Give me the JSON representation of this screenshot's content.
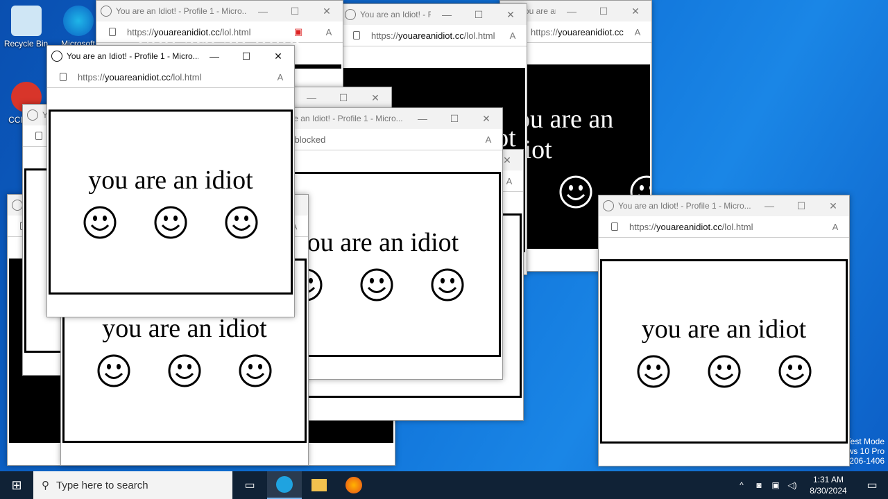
{
  "desktop": {
    "icons": [
      {
        "label": "Recycle Bin"
      },
      {
        "label": "Microsoft Edge"
      },
      {
        "label": "CCleaner"
      }
    ],
    "watermark": [
      "Test Mode",
      "Windows 10 Pro",
      "Build 19041.vb_release.191206-1406"
    ]
  },
  "windows": [
    {
      "title": "You are an Idiot! - Profile 1 - Micro...",
      "url_pre": "https://",
      "url_host": "youareanidiot.cc",
      "url_path": "/lol.html",
      "text": "you are an idiot",
      "theme": "black",
      "popup": ""
    },
    {
      "title": "You are an Idiot! - Profile 1 - Micro...",
      "url_pre": "https://",
      "url_host": "youareanidiot.cc",
      "url_path": "/lol.html",
      "text": "you are an idiot",
      "theme": "black",
      "popup": ""
    },
    {
      "title": "You are an Idiot! - Profile 1 - Micro...",
      "url_pre": "https://",
      "url_host": "youareanidiot.cc",
      "url_path": "/lol.html",
      "text": "you are an idiot",
      "theme": "black",
      "popup": ""
    },
    {
      "title": "You are an Idiot! - Profile 1 - Micro...",
      "url_pre": "https://",
      "url_host": "youareanidiot.cc",
      "url_path": "/lol.html",
      "text": "you are an idiot",
      "theme": "black",
      "popup": ""
    },
    {
      "title": "You are an Idiot! - Profile 1 - Micro...",
      "url_pre": "https://",
      "url_host": "youareanidiot.cc",
      "url_path": "/lol.html",
      "text": "you are an idiot",
      "theme": "white",
      "popup": ""
    },
    {
      "title": "You are an Idiot! - Profile 1 - Micro...",
      "url_pre": "https://",
      "url_host": "youareanidiot.cc",
      "url_path": "/lol.html",
      "text": "you are an idiot",
      "theme": "black",
      "popup": ""
    },
    {
      "title": "You are an Idiot! - Profile 1 - Micro...",
      "url_pre": "https://",
      "url_host": "youareanidiot.cc",
      "url_path": "/lol.html",
      "text": "you are an idiot",
      "theme": "white",
      "popup": ""
    },
    {
      "title": "You are an Idiot! - Profile 1 - Micro...",
      "url_pre": "",
      "url_host": "",
      "url_path": "",
      "text": "you are an idiot",
      "theme": "white",
      "popup": "Pop-up blocked"
    },
    {
      "title": "You are an Idiot! - Profile 1 - Micro...",
      "url_pre": "https://",
      "url_host": "youareanidiot.cc",
      "url_path": "/lol.html",
      "text": "you are an idiot",
      "theme": "white",
      "popup": ""
    },
    {
      "title": "You are an Idiot! - Profile 1 - Micro...",
      "url_pre": "https://",
      "url_host": "youareanidiot.cc",
      "url_path": "/lol.html",
      "text": "you are an idiot",
      "theme": "white",
      "popup": ""
    },
    {
      "title": "You are an Idiot! - Profile 1 - Micro...",
      "url_pre": "https://",
      "url_host": "youareanidiot.cc",
      "url_path": "/lol.html",
      "text": "you are an idiot",
      "theme": "white",
      "popup": ""
    }
  ],
  "taskbar": {
    "search_placeholder": "Type here to search",
    "time": "1:31 AM",
    "date": "8/30/2024"
  }
}
